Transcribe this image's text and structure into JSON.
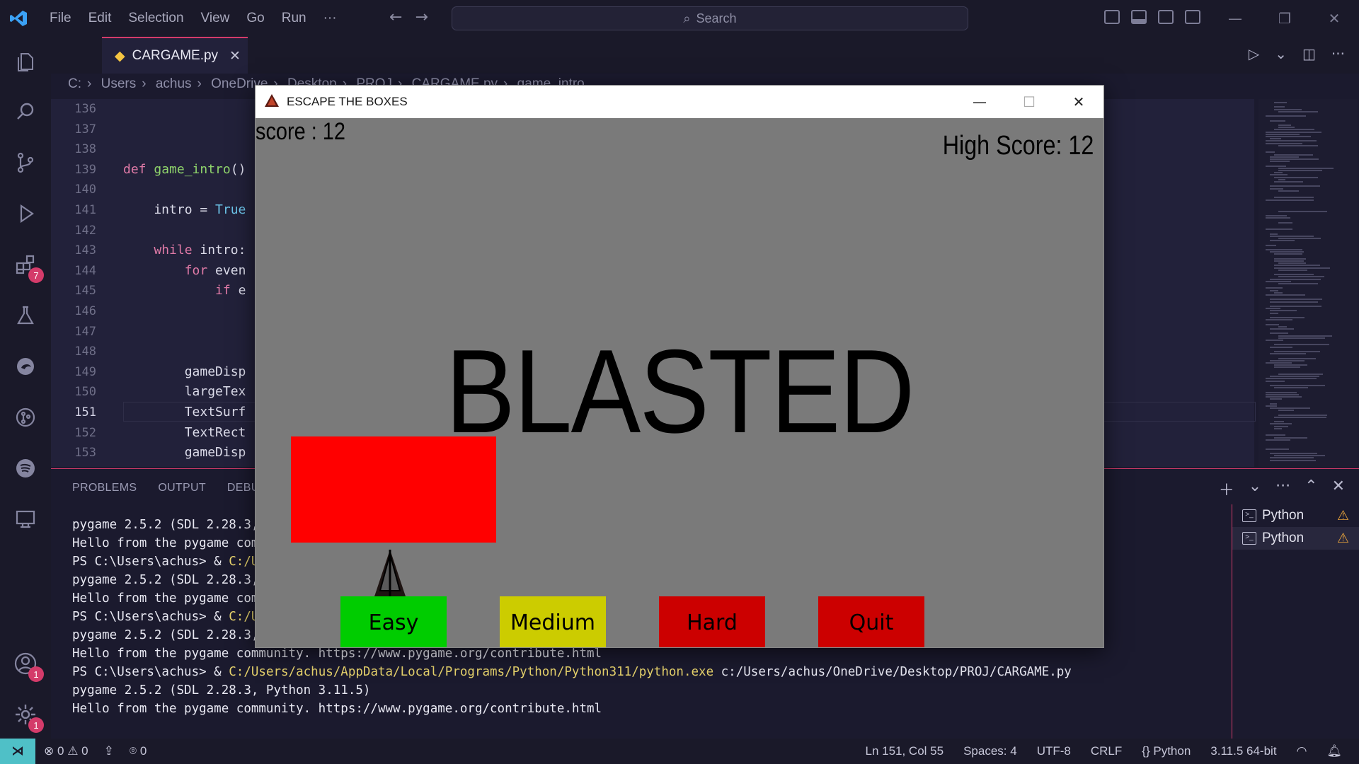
{
  "titlebar": {
    "menu": [
      "File",
      "Edit",
      "Selection",
      "View",
      "Go",
      "Run",
      "···"
    ],
    "search_placeholder": "Search"
  },
  "activity": {
    "extensions_badge": "7",
    "accounts_badge": "1",
    "settings_badge": "1"
  },
  "editor": {
    "tab_label": "CARGAME.py",
    "breadcrumb": [
      "C:",
      "Users",
      "achus",
      "OneDrive",
      "Desktop",
      "PROJ",
      "CARGAME.py",
      "game_intro"
    ],
    "line_numbers": [
      "136",
      "137",
      "138",
      "139",
      "140",
      "141",
      "142",
      "143",
      "144",
      "145",
      "146",
      "147",
      "148",
      "149",
      "150",
      "151",
      "152",
      "153"
    ],
    "active_line": "151"
  },
  "panel": {
    "tabs": [
      "PROBLEMS",
      "OUTPUT",
      "DEBUG CONSOLE"
    ],
    "terminal_lines": [
      {
        "prefix": "pygame 2.5.2 (SDL 2.28.3, Python 3.11.5)",
        "path": "",
        "suffix": ""
      },
      {
        "prefix": "Hello from the pygame community. https://www.pygame.org/contribute.html",
        "path": "",
        "suffix": ""
      },
      {
        "prefix": "PS C:\\Users\\achus> & ",
        "path": "C:/Users/achus/AppData/Local/Programs/Python/Python311/python.exe",
        "suffix": " c:/Users/achus/OneDrive/Desktop/PROJ/CARGAME.py"
      },
      {
        "prefix": "pygame 2.5.2 (SDL 2.28.3, Python 3.11.5)",
        "path": "",
        "suffix": ""
      },
      {
        "prefix": "Hello from the pygame community. https://www.pygame.org/contribute.html",
        "path": "",
        "suffix": ""
      },
      {
        "prefix": "PS C:\\Users\\achus> & ",
        "path": "C:/Users/achus/AppData/Local/Programs/Python/Python311/python.exe",
        "suffix": " c:/Users/achus/OneDrive/Desktop/PROJ/CARGAME.py"
      },
      {
        "prefix": "pygame 2.5.2 (SDL 2.28.3, Python 3.11.5)",
        "path": "",
        "suffix": ""
      },
      {
        "prefix": "Hello from the pygame community. https://www.pygame.org/contribute.html",
        "path": "",
        "suffix": ""
      },
      {
        "prefix": "PS C:\\Users\\achus> & ",
        "path": "C:/Users/achus/AppData/Local/Programs/Python/Python311/python.exe",
        "suffix": " c:/Users/achus/OneDrive/Desktop/PROJ/CARGAME.py"
      },
      {
        "prefix": "pygame 2.5.2 (SDL 2.28.3, Python 3.11.5)",
        "path": "",
        "suffix": ""
      },
      {
        "prefix": "Hello from the pygame community. https://www.pygame.org/contribute.html",
        "path": "",
        "suffix": ""
      }
    ],
    "terminals": [
      "Python",
      "Python"
    ]
  },
  "statusbar": {
    "errors": "0",
    "warnings": "0",
    "ports": "0",
    "position": "Ln 151, Col 55",
    "spaces": "Spaces: 4",
    "encoding": "UTF-8",
    "eol": "CRLF",
    "language": "Python",
    "interpreter": "3.11.5 64-bit"
  },
  "game": {
    "window_title": "ESCAPE THE BOXES",
    "score": "score : 12",
    "high_score": "High Score: 12",
    "message": "BLASTED",
    "buttons": [
      {
        "label": "Easy",
        "color": "#00cc00"
      },
      {
        "label": "Medium",
        "color": "#cccc00"
      },
      {
        "label": "Hard",
        "color": "#cc0000"
      },
      {
        "label": "Quit",
        "color": "#cc0000"
      }
    ],
    "obstacle_color": "#ff0000"
  },
  "colors": {
    "accent": "#d43b6a",
    "bg": "#1b1a2e",
    "editor_bg": "#22213a"
  }
}
